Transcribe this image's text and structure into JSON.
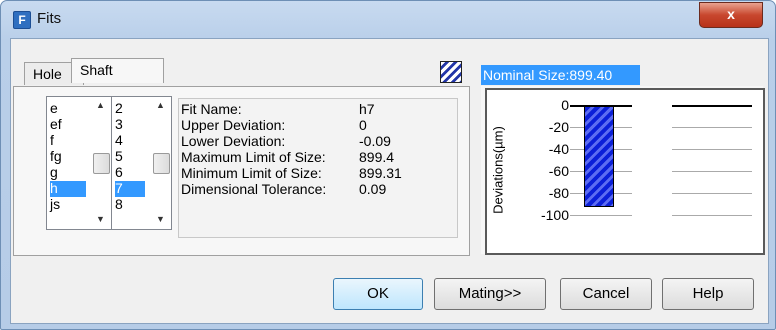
{
  "window": {
    "title": "Fits",
    "close_symbol": "x"
  },
  "tabs": [
    {
      "label": "Hole",
      "active": false
    },
    {
      "label": "Shaft",
      "active": true
    }
  ],
  "hole_list": {
    "items": [
      "e",
      "ef",
      "f",
      "fg",
      "g",
      "h",
      "js"
    ],
    "selected": "h"
  },
  "grade_list": {
    "items": [
      "2",
      "3",
      "4",
      "5",
      "6",
      "7",
      "8"
    ],
    "selected": "7"
  },
  "info": {
    "fit_name_label": "Fit Name:",
    "fit_name_value": "h7",
    "upper_label": "Upper Deviation:",
    "upper_value": "0",
    "lower_label": "Lower Deviation:",
    "lower_value": "-0.09",
    "max_label": "Maximum Limit of Size:",
    "max_value": "899.4",
    "min_label": "Minimum Limit of Size:",
    "min_value": "899.31",
    "tol_label": "Dimensional Tolerance:",
    "tol_value": "0.09"
  },
  "graph": {
    "nominal": "Nominal Size:899.40",
    "ylabel": "Deviations(µm)",
    "ticks": [
      "0",
      "-20",
      "-40",
      "-60",
      "-80",
      "-100"
    ],
    "tolerance_zone_um": {
      "upper": 0,
      "lower": -90
    },
    "bar_color": "#0b1fd8"
  },
  "buttons": {
    "ok": "OK",
    "mating": "Mating>>",
    "cancel": "Cancel",
    "help": "Help"
  }
}
